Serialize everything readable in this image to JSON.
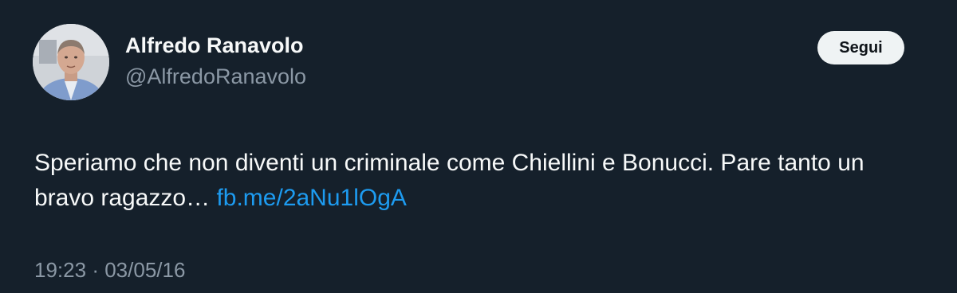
{
  "colors": {
    "background": "#15202b",
    "primary_text": "#f7f9f9",
    "secondary_text": "#8b98a5",
    "link": "#1d9bf0",
    "button_bg": "#eff3f4",
    "button_text": "#0f1419"
  },
  "author": {
    "display_name": "Alfredo Ranavolo",
    "handle": "@AlfredoRanavolo",
    "avatar": "profile-photo"
  },
  "follow_button": {
    "label": "Segui"
  },
  "tweet": {
    "text": "Speriamo che non diventi un criminale come Chiellini e Bonucci. Pare tanto un bravo ragazzo…",
    "link": "fb.me/2aNu1lOgA"
  },
  "meta": {
    "time": "19:23",
    "separator": "·",
    "date": "03/05/16"
  }
}
